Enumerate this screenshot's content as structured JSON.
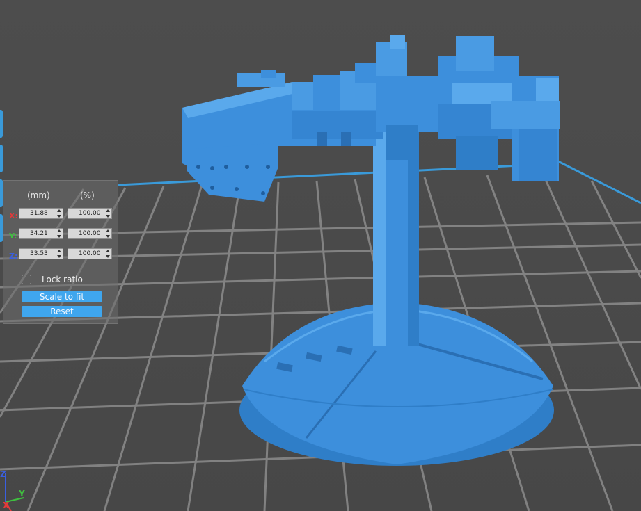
{
  "scale_panel": {
    "mm_header": "(mm)",
    "pct_header": "(%)",
    "rows": [
      {
        "axis": "X:",
        "mm": "31.88",
        "pct": "100.00",
        "color": "#e33a3a"
      },
      {
        "axis": "Y:",
        "mm": "34.21",
        "pct": "100.00",
        "color": "#3fbf3f"
      },
      {
        "axis": "Z:",
        "mm": "33.53",
        "pct": "100.00",
        "color": "#3a5fe0"
      }
    ],
    "lock_ratio_label": "Lock ratio",
    "lock_ratio_checked": false,
    "scale_to_fit_label": "Scale to fit",
    "reset_label": "Reset"
  },
  "gizmo": {
    "z_label": "Z",
    "y_label": "Y",
    "x_label": "X",
    "x_color": "#e33a3a",
    "y_color": "#3fbf3f",
    "z_color": "#3a5fe0"
  },
  "colors": {
    "model": "#3d8fdc",
    "model_dark": "#2f78c0",
    "model_light": "#5aa9ec",
    "grid": "#8a8a8a",
    "build_plate_border": "#3a9ad9",
    "accent": "#3fa6ee"
  }
}
